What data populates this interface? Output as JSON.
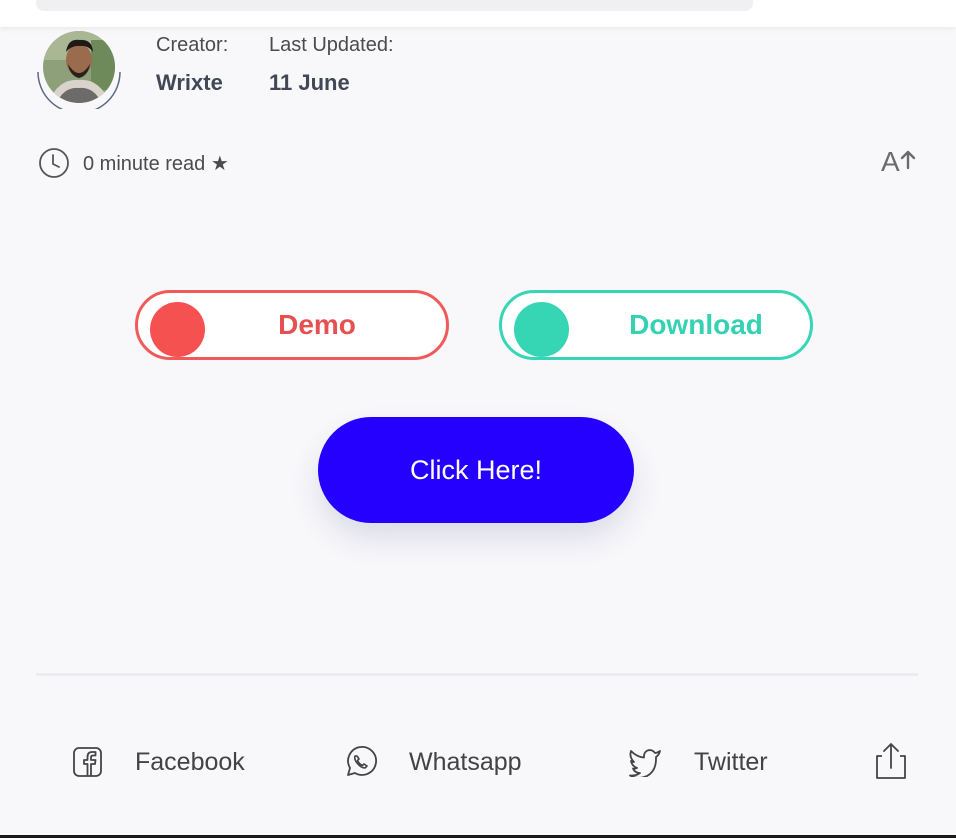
{
  "author": {
    "creator_label": "Creator:",
    "creator_name": "Wrixte",
    "updated_label": "Last Updated:",
    "updated_date": "11 June",
    "avatar_icon": "author-avatar"
  },
  "article": {
    "read_time": "0 minute read ★",
    "clock_icon": "clock-icon",
    "font_size_icon": "font-size-increase-icon",
    "font_size_label": "A"
  },
  "buttons": {
    "demo_label": "Demo",
    "download_label": "Download",
    "click_label": "Click Here!"
  },
  "colors": {
    "demo": "#f05a5a",
    "download": "#37d5b5",
    "cta": "#2500ff",
    "background": "#f8f8fb"
  },
  "share": {
    "facebook_label": "Facebook",
    "whatsapp_label": "Whatsapp",
    "twitter_label": "Twitter",
    "share_icon": "share-icon"
  }
}
